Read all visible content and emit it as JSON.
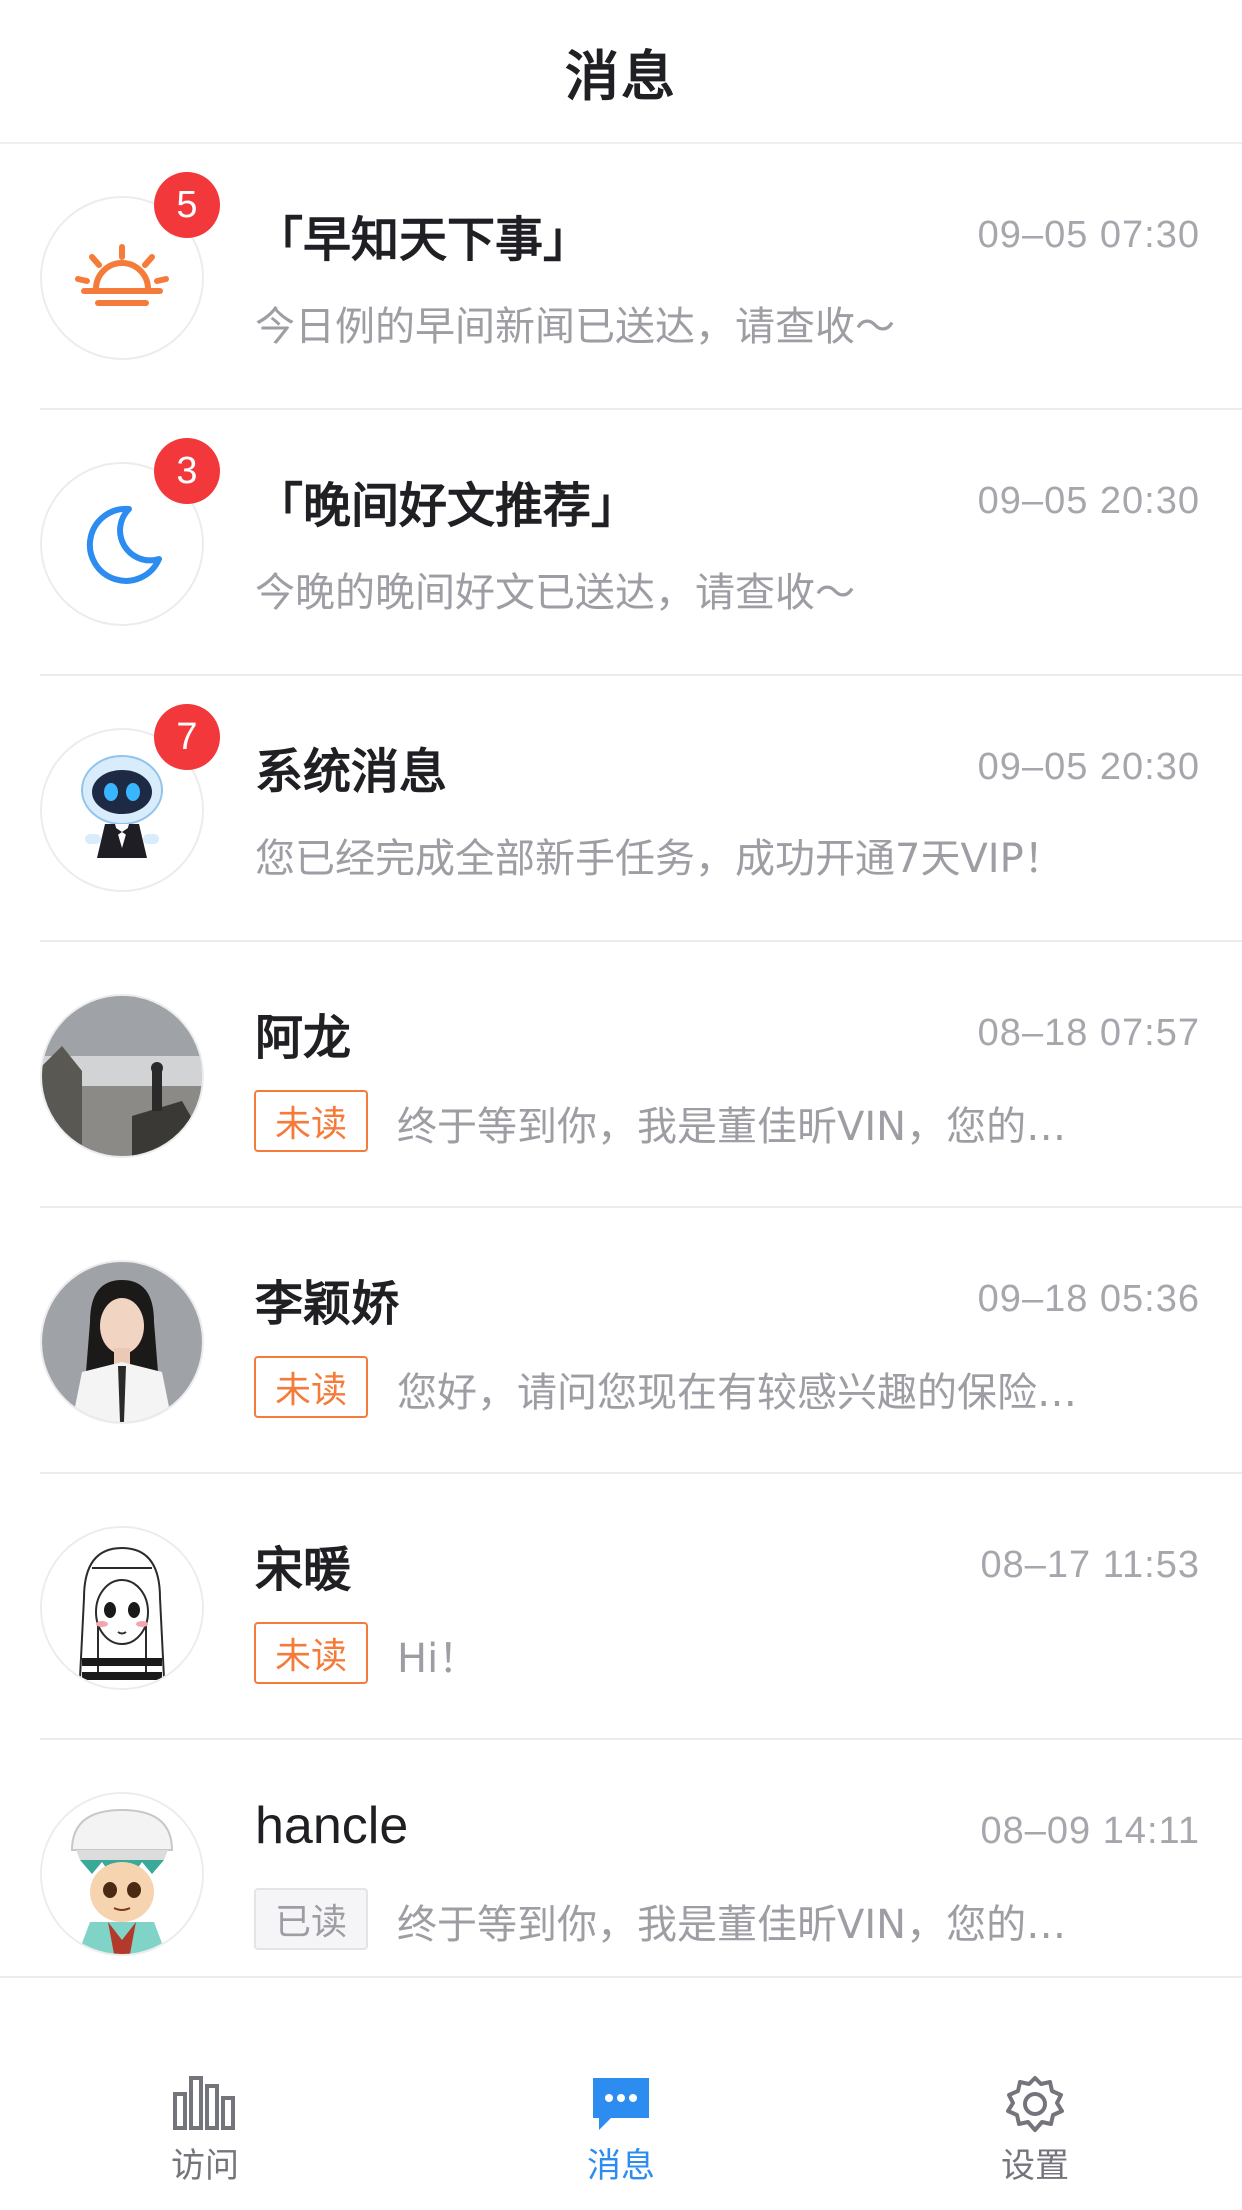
{
  "header": {
    "title": "消息"
  },
  "messages": [
    {
      "name": "「早知天下事」",
      "time": "09–05   07:30",
      "preview": "今日例的早间新闻已送达，请查收～",
      "badge": "5",
      "avatar_icon": "sunrise-icon",
      "accent": "#f57b3a"
    },
    {
      "name": "「晚间好文推荐」",
      "time": "09–05   20:30",
      "preview": "今晚的晚间好文已送达，请查收～",
      "badge": "3",
      "avatar_icon": "moon-icon",
      "accent": "#2d8cf0"
    },
    {
      "name": "系统消息",
      "time": "09–05   20:30",
      "preview": "您已经完成全部新手任务，成功开通7天VIP！",
      "badge": "7",
      "avatar_icon": "robot-icon"
    },
    {
      "name": "阿龙",
      "time": "08–18   07:57",
      "tag": "未读",
      "preview": "终于等到你，我是董佳昕VIN，您的…",
      "avatar_icon": "user-photo-avatar"
    },
    {
      "name": "李颖娇",
      "time": "09–18   05:36",
      "tag": "未读",
      "preview": "您好，请问您现在有较感兴趣的保险…",
      "avatar_icon": "user-photo-avatar"
    },
    {
      "name": "宋暖",
      "time": "08–17   11:53",
      "tag": "未读",
      "preview": "Hi！",
      "avatar_icon": "illustrated-girl-avatar"
    },
    {
      "name": "hancle",
      "time": "08–09   14:11",
      "tag": "已读",
      "preview": "终于等到你，我是董佳昕VIN，您的…",
      "avatar_icon": "cartoon-boy-avatar"
    }
  ],
  "tabbar": {
    "tabs": [
      {
        "label": "访问",
        "icon": "bar-chart-icon",
        "active": false
      },
      {
        "label": "消息",
        "icon": "chat-bubble-icon",
        "active": true
      },
      {
        "label": "设置",
        "icon": "gear-icon",
        "active": false
      }
    ],
    "active_color": "#2d8cf0"
  },
  "colors": {
    "badge": "#f2383a",
    "unread_tag": "#f57b3a",
    "read_tag_bg": "#f5f5f7"
  }
}
